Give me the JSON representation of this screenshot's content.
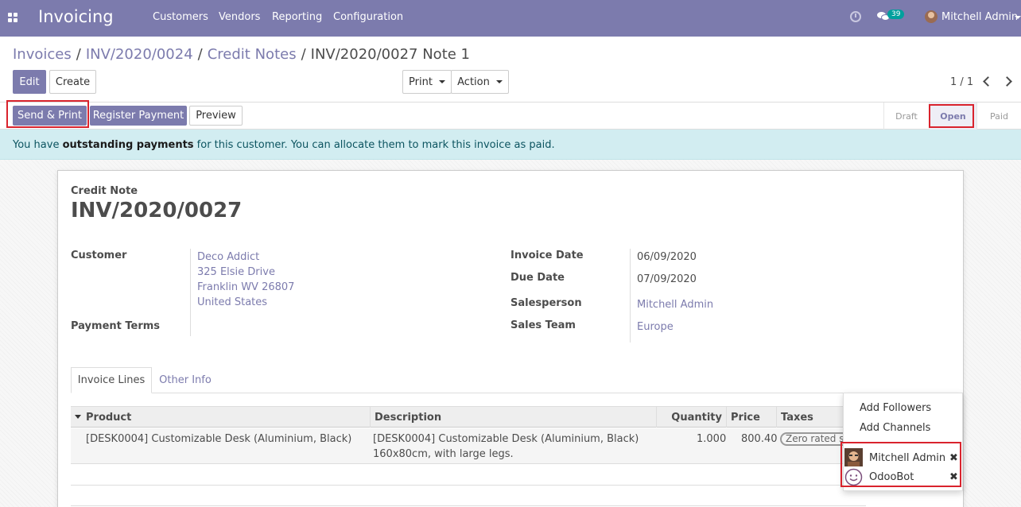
{
  "navbar": {
    "brand": "Invoicing",
    "menu": [
      "Customers",
      "Vendors",
      "Reporting",
      "Configuration"
    ],
    "chat_count": "39",
    "user_name": "Mitchell Admin"
  },
  "breadcrumb": {
    "items": [
      "Invoices",
      "INV/2020/0024",
      "Credit Notes"
    ],
    "current": "INV/2020/0027 Note 1"
  },
  "toolbar": {
    "edit_label": "Edit",
    "create_label": "Create",
    "print_label": "Print",
    "action_label": "Action",
    "pager": "1 / 1"
  },
  "statusbar": {
    "send_print_label": "Send & Print",
    "register_payment_label": "Register Payment",
    "preview_label": "Preview",
    "stages": [
      "Draft",
      "Open",
      "Paid"
    ],
    "active_stage": "Open"
  },
  "alert": {
    "prefix": "You have ",
    "bold": "outstanding payments",
    "suffix": " for this customer. You can allocate them to mark this invoice as paid."
  },
  "document": {
    "type_label": "Credit Note",
    "number": "INV/2020/0027"
  },
  "fields": {
    "customer_label": "Customer",
    "customer_name": "Deco Addict",
    "customer_street": "325 Elsie Drive",
    "customer_city": "Franklin WV 26807",
    "customer_country": "United States",
    "payment_terms_label": "Payment Terms",
    "invoice_date_label": "Invoice Date",
    "invoice_date": "06/09/2020",
    "due_date_label": "Due Date",
    "due_date": "07/09/2020",
    "salesperson_label": "Salesperson",
    "salesperson": "Mitchell Admin",
    "sales_team_label": "Sales Team",
    "sales_team": "Europe"
  },
  "tabs": [
    "Invoice Lines",
    "Other Info"
  ],
  "table": {
    "headers": [
      "Product",
      "Description",
      "Quantity",
      "Price",
      "Taxes"
    ],
    "rows": [
      {
        "product": "[DESK0004] Customizable Desk (Aluminium, Black)",
        "description_line1": "[DESK0004] Customizable Desk (Aluminium, Black)",
        "description_line2": "160x80cm, with large legs.",
        "quantity": "1.000",
        "price": "800.40",
        "taxes": "Zero rated sales"
      }
    ]
  },
  "followers_dropdown": {
    "add_followers_label": "Add Followers",
    "add_channels_label": "Add Channels",
    "followers": [
      "Mitchell Admin",
      "OdooBot"
    ]
  },
  "colors": {
    "brand": "#7c7bad",
    "alert_bg": "#d2edf1",
    "highlight_red": "#d9232d"
  }
}
